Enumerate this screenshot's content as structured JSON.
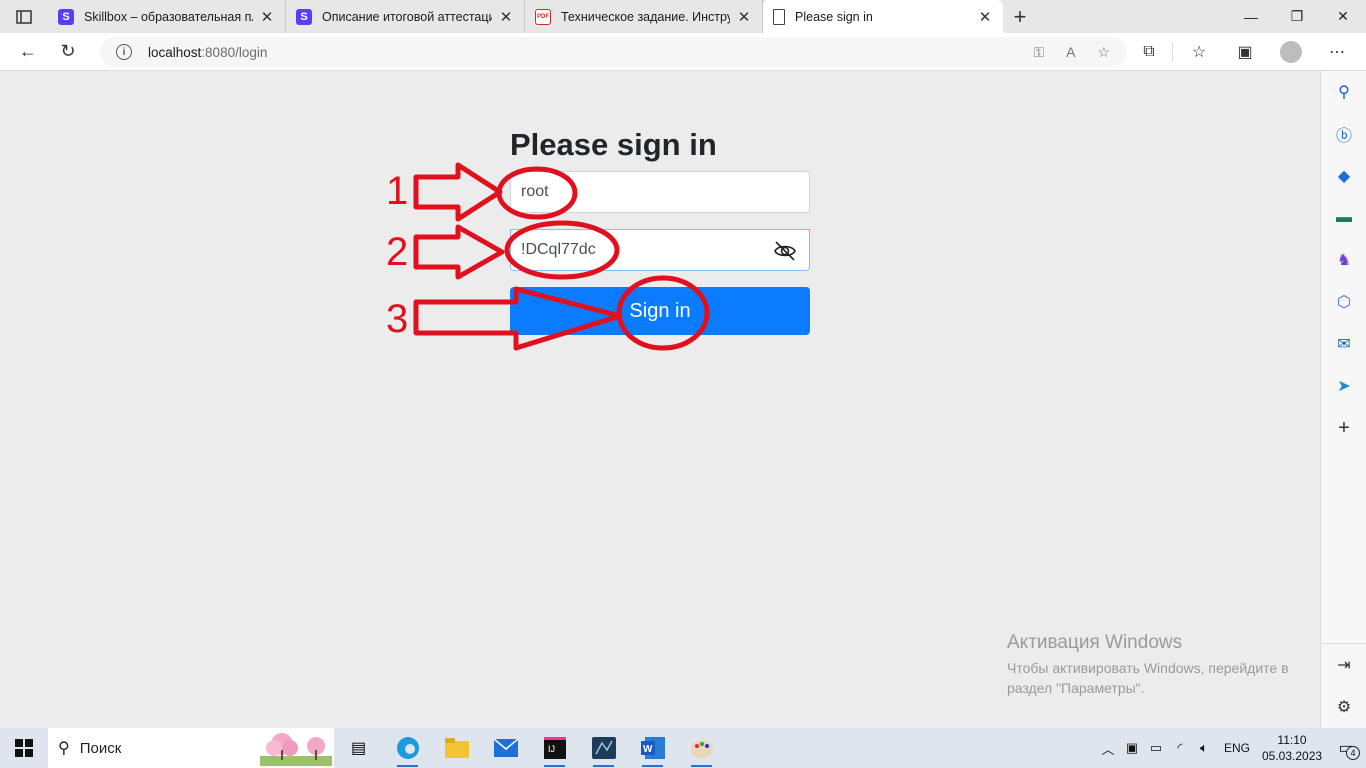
{
  "tabs": [
    {
      "title": "Skillbox – образовательная плат",
      "favicon": "S",
      "color": "#5b3df5",
      "active": false
    },
    {
      "title": "Описание итоговой аттестации",
      "favicon": "S",
      "color": "#5b3df5",
      "active": false
    },
    {
      "title": "Техническое задание. Инструкц",
      "favicon": "pdf-icon",
      "color": "#c4302b",
      "active": false
    },
    {
      "title": "Please sign in",
      "favicon": "page-icon",
      "color": "#ffffff",
      "active": true
    }
  ],
  "address": {
    "host": "localhost",
    "path": ":8080/login"
  },
  "page": {
    "heading": "Please sign in",
    "username_value": "root",
    "password_value": "!DCql77dc",
    "submit_label": "Sign in"
  },
  "annotations": {
    "step1": "1",
    "step2": "2",
    "step3": "3",
    "color": "#e0101e"
  },
  "watermark": {
    "title": "Активация Windows",
    "text": "Чтобы активировать Windows, перейдите в раздел \"Параметры\"."
  },
  "taskbar": {
    "search_placeholder": "Поиск",
    "lang": "ENG",
    "time": "11:10",
    "date": "05.03.2023",
    "notifications": "4"
  }
}
